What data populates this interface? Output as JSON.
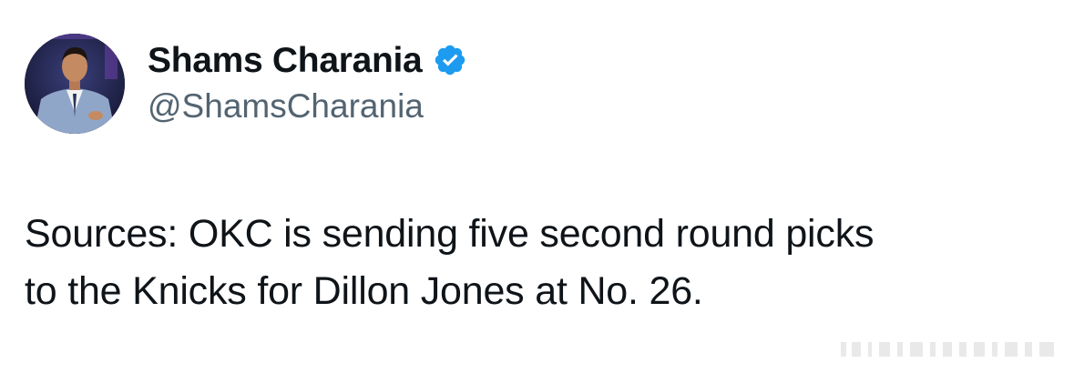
{
  "tweet": {
    "author": {
      "display_name": "Shams Charania",
      "handle": "@ShamsCharania",
      "verified": true,
      "verified_color": "#1d9bf0",
      "avatar_icon": "profile-photo"
    },
    "text_lines": [
      "Sources: OKC is sending five second round picks",
      "to the Knicks for Dillon Jones at No. 26."
    ]
  },
  "colors": {
    "text_primary": "#0f1419",
    "text_secondary": "#536471",
    "background": "#ffffff"
  }
}
